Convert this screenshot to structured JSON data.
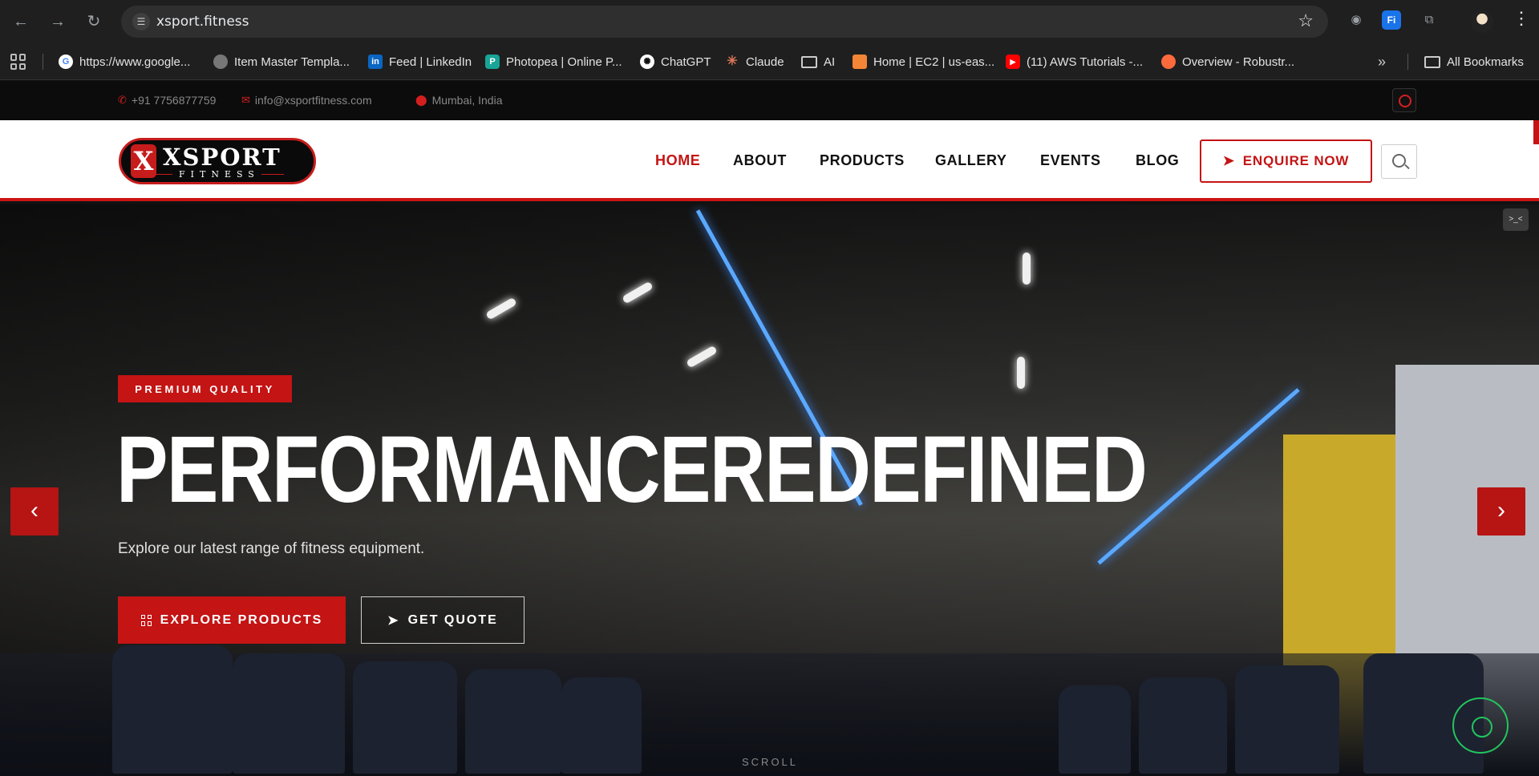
{
  "browser": {
    "url": "xsport.fitness",
    "bookmarks": [
      {
        "label": "https://www.google...",
        "color": "#4285f4",
        "glyph": "G"
      },
      {
        "label": "Item Master Templa...",
        "color": "#888888",
        "glyph": ""
      },
      {
        "label": "Feed | LinkedIn",
        "color": "#0a66c2",
        "glyph": "in"
      },
      {
        "label": "Photopea | Online P...",
        "color": "#18a497",
        "glyph": "P"
      },
      {
        "label": "ChatGPT",
        "color": "#ffffff",
        "glyph": ""
      },
      {
        "label": "Claude",
        "color": "#d97757",
        "glyph": "✳"
      },
      {
        "label": "AI",
        "color": "#1f1f1f",
        "glyph": "▭"
      },
      {
        "label": "Home | EC2 | us-eas...",
        "color": "#f58536",
        "glyph": ""
      },
      {
        "label": "(11) AWS Tutorials -...",
        "color": "#ff0000",
        "glyph": "▶"
      },
      {
        "label": "Overview - Robustr...",
        "color": "#ff6a3d",
        "glyph": ""
      }
    ],
    "all_bookmarks": "All Bookmarks"
  },
  "topbar": {
    "phone": "+91 7756877759",
    "email": "info@xsportfitness.com",
    "location": "Mumbai, India"
  },
  "logo": {
    "name": "XSPORT",
    "sub": "FITNESS",
    "mark": "X"
  },
  "nav": {
    "home": "HOME",
    "about": "ABOUT",
    "products": "PRODUCTS",
    "gallery": "GALLERY",
    "events": "EVENTS",
    "blog": "BLOG",
    "enquire": "ENQUIRE NOW"
  },
  "hero": {
    "badge": "PREMIUM QUALITY",
    "headline": "PERFORMANCEREDEFINED",
    "subtext": "Explore our latest range of fitness equipment.",
    "explore_btn": "EXPLORE PRODUCTS",
    "quote_btn": "GET QUOTE",
    "scroll": "SCROLL"
  },
  "colors": {
    "accent": "#c41414",
    "dark": "#0c0c0c"
  }
}
